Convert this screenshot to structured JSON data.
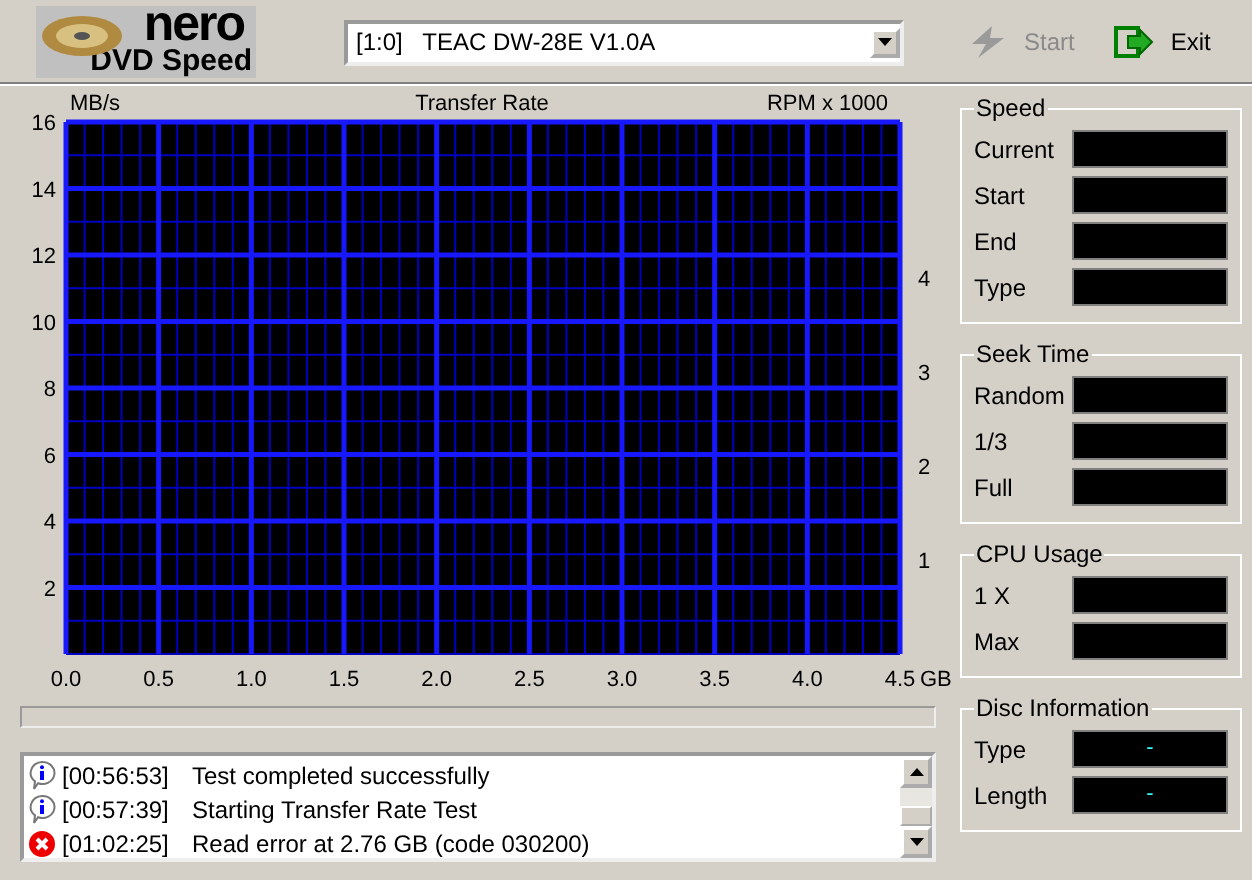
{
  "logo": {
    "brand": "nero",
    "product": "DVD Speed"
  },
  "drive_select": {
    "value": "[1:0]   TEAC DW-28E V1.0A"
  },
  "toolbar": [
    {
      "label": "Start",
      "kind": "start",
      "disabled": true
    },
    {
      "label": "Exit",
      "kind": "exit",
      "disabled": false
    }
  ],
  "chart": {
    "chart_data": {
      "type": "line",
      "title": "Transfer Rate",
      "xlabel": "GB",
      "ylabel": "MB/s",
      "xlim": [
        0,
        4.5
      ],
      "ylim": [
        0,
        16
      ],
      "xticks": [
        {
          "value": 0,
          "label": "0.0"
        },
        0.5,
        {
          "value": 1,
          "label": "1.0"
        },
        1.5,
        {
          "value": 2,
          "label": "2.0"
        },
        2.5,
        {
          "value": 3,
          "label": "3.0"
        },
        3.5,
        {
          "value": 4,
          "label": "4.0"
        },
        4.5
      ],
      "yticks": [
        2,
        4,
        6,
        8,
        10,
        12,
        14,
        16
      ],
      "grid": true
    },
    "rpm_axis": {
      "label": "RPM x 1000",
      "ticks": [
        "4",
        "3",
        "2",
        "1"
      ]
    }
  },
  "progress": {
    "level": 0
  },
  "log": [
    {
      "kind": "info",
      "time": "[00:56:53]",
      "message": "Test completed successfully"
    },
    {
      "kind": "info",
      "time": "[00:57:39]",
      "message": "Starting Transfer Rate Test"
    },
    {
      "kind": "error",
      "time": "[01:02:25]",
      "message": "Read error at 2.76 GB (code 030200)"
    }
  ],
  "panels": [
    {
      "title": "Speed",
      "fields": [
        {
          "label": "Current"
        },
        {
          "label": "Start"
        },
        {
          "label": "End"
        },
        {
          "label": "Type"
        }
      ]
    },
    {
      "title": "Seek Time",
      "fields": [
        {
          "label": "Random"
        },
        {
          "label": "1/3"
        },
        {
          "label": "Full"
        }
      ]
    },
    {
      "title": "CPU Usage",
      "fields": [
        {
          "label": "1 X"
        },
        {
          "label": "Max"
        }
      ]
    },
    {
      "title": "Disc Information",
      "fields": [
        {
          "label": "Type",
          "value": "-"
        },
        {
          "label": "Length",
          "value": "-"
        }
      ]
    }
  ]
}
